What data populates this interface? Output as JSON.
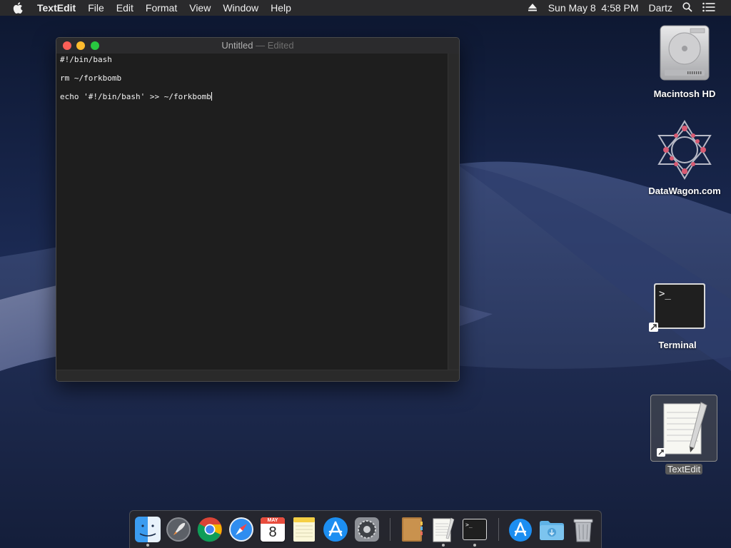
{
  "menubar": {
    "app_name": "TextEdit",
    "menus": [
      "File",
      "Edit",
      "Format",
      "View",
      "Window",
      "Help"
    ],
    "datetime": "Sun May 8  4:58 PM",
    "user": "Dartz"
  },
  "window": {
    "title": "Untitled",
    "title_suffix": "— Edited",
    "lines": [
      "#!/bin/bash",
      "rm ~/forkbomb",
      "echo '#!/bin/bash' >> ~/forkbomb"
    ]
  },
  "desktop": {
    "icons": [
      {
        "label": "Macintosh HD",
        "icon": "hard-drive-icon"
      },
      {
        "label": "DataWagon.com",
        "icon": "datawagon-logo-icon"
      },
      {
        "label": "Terminal",
        "icon": "terminal-icon"
      },
      {
        "label": "TextEdit",
        "icon": "textedit-icon"
      }
    ]
  },
  "dock": {
    "calendar_month": "MAY",
    "calendar_day": "8",
    "items": [
      "finder-icon",
      "launchpad-icon",
      "chrome-icon",
      "safari-icon",
      "calendar-icon",
      "notes-icon",
      "app-store-icon",
      "system-preferences-icon",
      "contacts-icon",
      "textedit-icon",
      "terminal-icon",
      "app-store-downloads-icon",
      "downloads-folder-icon",
      "trash-icon"
    ]
  },
  "colors": {
    "menubar_bg": "#2a2a2c",
    "window_bg": "#1e1e1e",
    "close": "#fc5f57",
    "minimize": "#fdbc2e",
    "maximize": "#28c840"
  }
}
